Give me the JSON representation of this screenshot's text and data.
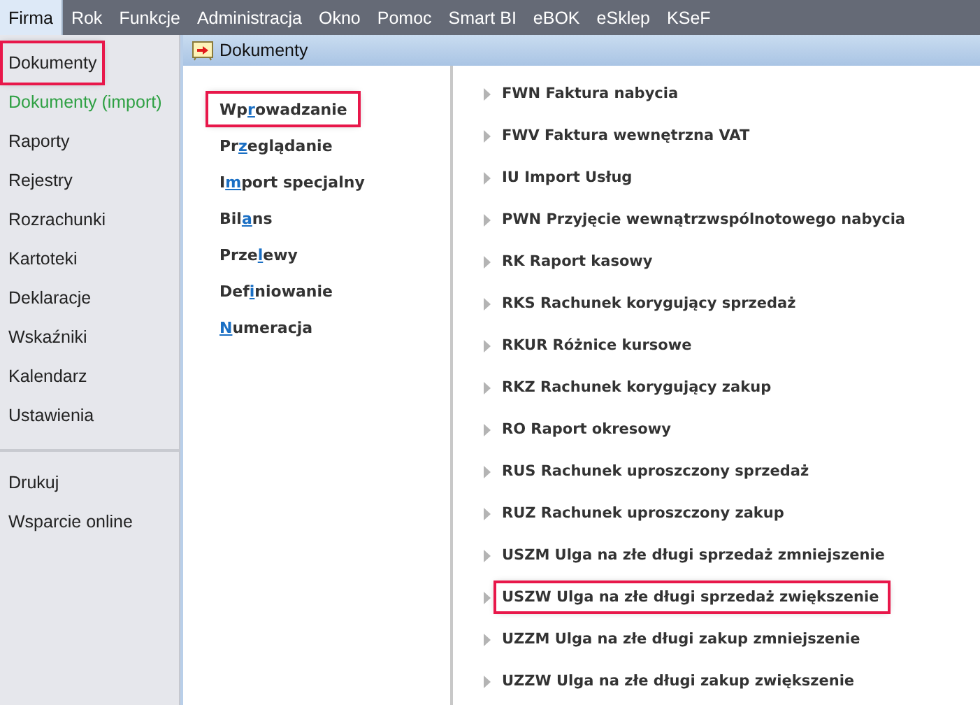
{
  "menu_bar": [
    {
      "label": "Firma",
      "selected": true
    },
    {
      "label": "Rok",
      "selected": false
    },
    {
      "label": "Funkcje",
      "selected": false
    },
    {
      "label": "Administracja",
      "selected": false
    },
    {
      "label": "Okno",
      "selected": false
    },
    {
      "label": "Pomoc",
      "selected": false
    },
    {
      "label": "Smart BI",
      "selected": false
    },
    {
      "label": "eBOK",
      "selected": false
    },
    {
      "label": "eSklep",
      "selected": false
    },
    {
      "label": "KSeF",
      "selected": false
    }
  ],
  "sidebar": {
    "groups": [
      [
        {
          "label": "Dokumenty",
          "highlighted": true
        },
        {
          "label": "Dokumenty (import)",
          "highlighted": false,
          "color": "#2ea043"
        },
        {
          "label": "Raporty",
          "highlighted": false
        },
        {
          "label": "Rejestry",
          "highlighted": false
        },
        {
          "label": "Rozrachunki",
          "highlighted": false
        },
        {
          "label": "Kartoteki",
          "highlighted": false
        },
        {
          "label": "Deklaracje",
          "highlighted": false
        },
        {
          "label": "Wskaźniki",
          "highlighted": false
        },
        {
          "label": "Kalendarz",
          "highlighted": false
        },
        {
          "label": "Ustawienia",
          "highlighted": false
        }
      ],
      [
        {
          "label": "Drukuj",
          "highlighted": false
        },
        {
          "label": "Wsparcie online",
          "highlighted": false
        }
      ]
    ]
  },
  "panel": {
    "title": "Dokumenty",
    "sections": [
      {
        "before": "Wp",
        "key": "r",
        "after": "owadzanie",
        "highlighted": true
      },
      {
        "before": "Pr",
        "key": "z",
        "after": "eglądanie",
        "highlighted": false
      },
      {
        "before": "I",
        "key": "m",
        "after": "port specjalny",
        "highlighted": false
      },
      {
        "before": "Bil",
        "key": "a",
        "after": "ns",
        "highlighted": false
      },
      {
        "before": "Prze",
        "key": "l",
        "after": "ewy",
        "highlighted": false
      },
      {
        "before": "Def",
        "key": "i",
        "after": "niowanie",
        "highlighted": false
      },
      {
        "key": "N",
        "after": "umeracja",
        "highlighted": false
      }
    ],
    "documents": [
      {
        "label": "FWN Faktura nabycia",
        "highlighted": false
      },
      {
        "label": "FWV Faktura wewnętrzna VAT",
        "highlighted": false
      },
      {
        "label": "IU Import Usług",
        "highlighted": false
      },
      {
        "label": "PWN Przyjęcie wewnątrzwspólnotowego nabycia",
        "highlighted": false
      },
      {
        "label": "RK Raport kasowy",
        "highlighted": false
      },
      {
        "label": "RKS Rachunek korygujący sprzedaż",
        "highlighted": false
      },
      {
        "label": "RKUR Różnice kursowe",
        "highlighted": false
      },
      {
        "label": "RKZ Rachunek korygujący zakup",
        "highlighted": false
      },
      {
        "label": "RO Raport okresowy",
        "highlighted": false
      },
      {
        "label": "RUS Rachunek uproszczony sprzedaż",
        "highlighted": false
      },
      {
        "label": "RUZ Rachunek uproszczony zakup",
        "highlighted": false
      },
      {
        "label": "USZM Ulga na złe długi sprzedaż zmniejszenie",
        "highlighted": false
      },
      {
        "label": "USZW Ulga na złe długi sprzedaż zwiększenie",
        "highlighted": true
      },
      {
        "label": "UZZM Ulga na złe długi zakup zmniejszenie",
        "highlighted": false
      },
      {
        "label": "UZZW Ulga na złe długi zakup zwiększenie",
        "highlighted": false
      }
    ]
  }
}
